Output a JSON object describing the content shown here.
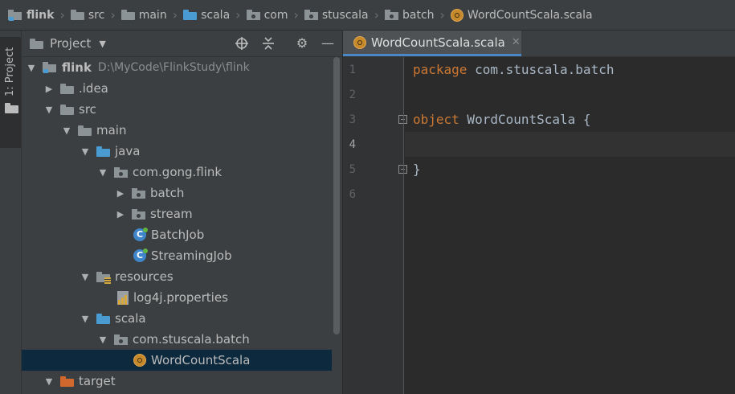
{
  "breadcrumb": [
    {
      "label": "flink",
      "icon": "module-folder-icon"
    },
    {
      "label": "src",
      "icon": "folder-icon"
    },
    {
      "label": "main",
      "icon": "folder-icon"
    },
    {
      "label": "scala",
      "icon": "source-folder-icon"
    },
    {
      "label": "com",
      "icon": "package-icon"
    },
    {
      "label": "stuscala",
      "icon": "package-icon"
    },
    {
      "label": "batch",
      "icon": "package-icon"
    },
    {
      "label": "WordCountScala.scala",
      "icon": "scala-object-icon"
    }
  ],
  "toolstrip": {
    "tab_label": "1: Project"
  },
  "project_panel": {
    "title": "Project",
    "tree": [
      {
        "label": "flink",
        "path": "D:\\MyCode\\FlinkStudy\\flink"
      },
      {
        "label": ".idea"
      },
      {
        "label": "src"
      },
      {
        "label": "main"
      },
      {
        "label": "java"
      },
      {
        "label": "com.gong.flink"
      },
      {
        "label": "batch"
      },
      {
        "label": "stream"
      },
      {
        "label": "BatchJob"
      },
      {
        "label": "StreamingJob"
      },
      {
        "label": "resources"
      },
      {
        "label": "log4j.properties"
      },
      {
        "label": "scala"
      },
      {
        "label": "com.stuscala.batch"
      },
      {
        "label": "WordCountScala"
      },
      {
        "label": "target"
      }
    ]
  },
  "editor": {
    "tab_label": "WordCountScala.scala",
    "line_numbers": [
      "1",
      "2",
      "3",
      "4",
      "5",
      "6"
    ],
    "code": {
      "l1_kw": "package",
      "l1_rest": " com.stuscala.batch",
      "l3_kw": "object",
      "l3_rest": " WordCountScala {",
      "l5": "}"
    }
  },
  "colors": {
    "keyword": "#cc7832",
    "text": "#a9b7c6",
    "selection": "#0d293e",
    "accent": "#4a88c7"
  }
}
